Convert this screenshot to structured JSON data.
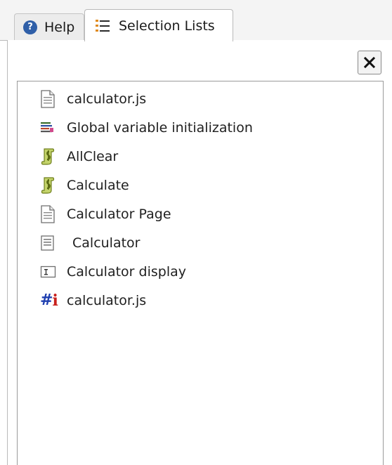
{
  "tabs": [
    {
      "label": "Help",
      "icon": "help-circle-icon",
      "active": false
    },
    {
      "label": "Selection Lists",
      "icon": "list-icon",
      "active": true
    }
  ],
  "panel": {
    "close_label": "×"
  },
  "list": {
    "items": [
      {
        "label": "calculator.js",
        "icon": "document-icon"
      },
      {
        "label": "Global variable initialization",
        "icon": "variables-icon"
      },
      {
        "label": "AllClear",
        "icon": "script-icon"
      },
      {
        "label": "Calculate",
        "icon": "script-icon"
      },
      {
        "label": "Calculator Page",
        "icon": "page-icon"
      },
      {
        "label": "Calculator",
        "icon": "form-icon"
      },
      {
        "label": "Calculator display",
        "icon": "textfield-icon"
      },
      {
        "label": "calculator.js",
        "icon": "hash-info-icon"
      }
    ]
  },
  "colors": {
    "help_icon": "#2f5fa8",
    "hash_blue": "#1f3fb0",
    "info_red": "#c8201c",
    "script_green": "#8aa52a",
    "list_orange": "#e08a1e"
  }
}
